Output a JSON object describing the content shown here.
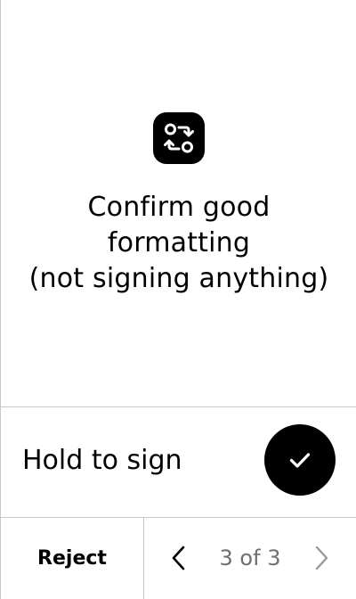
{
  "app": {
    "icon": "swap-arrows-icon"
  },
  "message": {
    "lines": [
      "Confirm good",
      "formatting",
      "(not signing anything)"
    ]
  },
  "hold": {
    "label": "Hold to sign",
    "icon": "checkmark-icon"
  },
  "footer": {
    "reject_label": "Reject",
    "page_indicator": "3 of 3",
    "current_page": 3,
    "total_pages": 3,
    "prev_icon": "chevron-left-icon",
    "next_icon": "chevron-right-icon"
  },
  "colors": {
    "background": "#ffffff",
    "foreground": "#000000",
    "divider": "#c9c9c9",
    "muted_text": "#707070",
    "disabled_chevron": "#9a9a9a"
  }
}
